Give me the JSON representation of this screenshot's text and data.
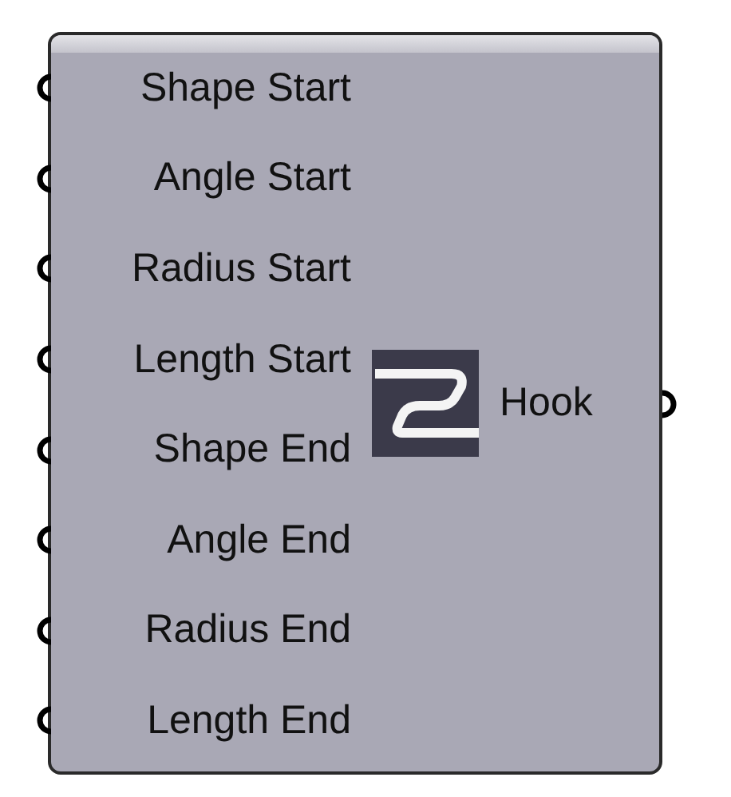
{
  "component": {
    "inputs": [
      {
        "label": "Shape Start"
      },
      {
        "label": "Angle Start"
      },
      {
        "label": "Radius Start"
      },
      {
        "label": "Length Start"
      },
      {
        "label": "Shape End"
      },
      {
        "label": "Angle End"
      },
      {
        "label": "Radius End"
      },
      {
        "label": "Length End"
      }
    ],
    "outputs": [
      {
        "label": "Hook"
      }
    ]
  }
}
